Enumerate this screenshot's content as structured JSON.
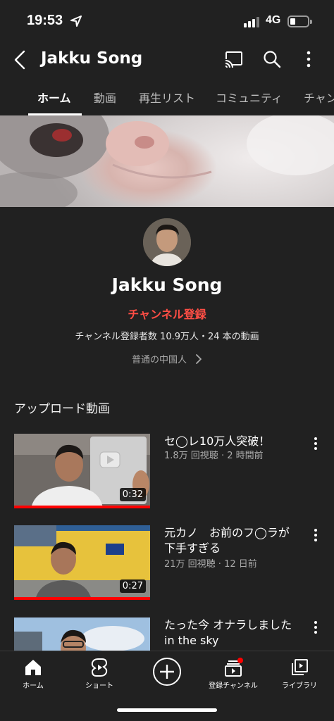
{
  "status_bar": {
    "time": "19:53",
    "network": "4G",
    "battery_level": 0.25
  },
  "header": {
    "title": "Jakku Song"
  },
  "tabs": [
    {
      "label": "ホーム",
      "active": true
    },
    {
      "label": "動画"
    },
    {
      "label": "再生リスト"
    },
    {
      "label": "コミュニティ"
    },
    {
      "label": "チャン"
    }
  ],
  "channel": {
    "name": "Jakku Song",
    "subscribe_label": "チャンネル登録",
    "stats": "チャンネル登録者数 10.9万人・24 本の動画",
    "description": "普通の中国人"
  },
  "section": {
    "title": "アップロード動画"
  },
  "videos": [
    {
      "title": "セ◯レ10万人突破！",
      "meta": "1.8万 回視聴 · 2 時間前",
      "duration": "0:32"
    },
    {
      "title": "元カノ　お前のフ◯ラが下手すぎる",
      "meta": "21万 回視聴 · 12 日前",
      "duration": "0:27"
    },
    {
      "title": "たった今 オナラしました in the sky",
      "meta": "",
      "duration": ""
    }
  ],
  "bottom_nav": {
    "home": "ホーム",
    "shorts": "ショート",
    "subscriptions": "登録チャンネル",
    "library": "ライブラリ"
  },
  "colors": {
    "background": "#212121",
    "accent_red": "#ff4e45",
    "progress_red": "#ff0000"
  }
}
